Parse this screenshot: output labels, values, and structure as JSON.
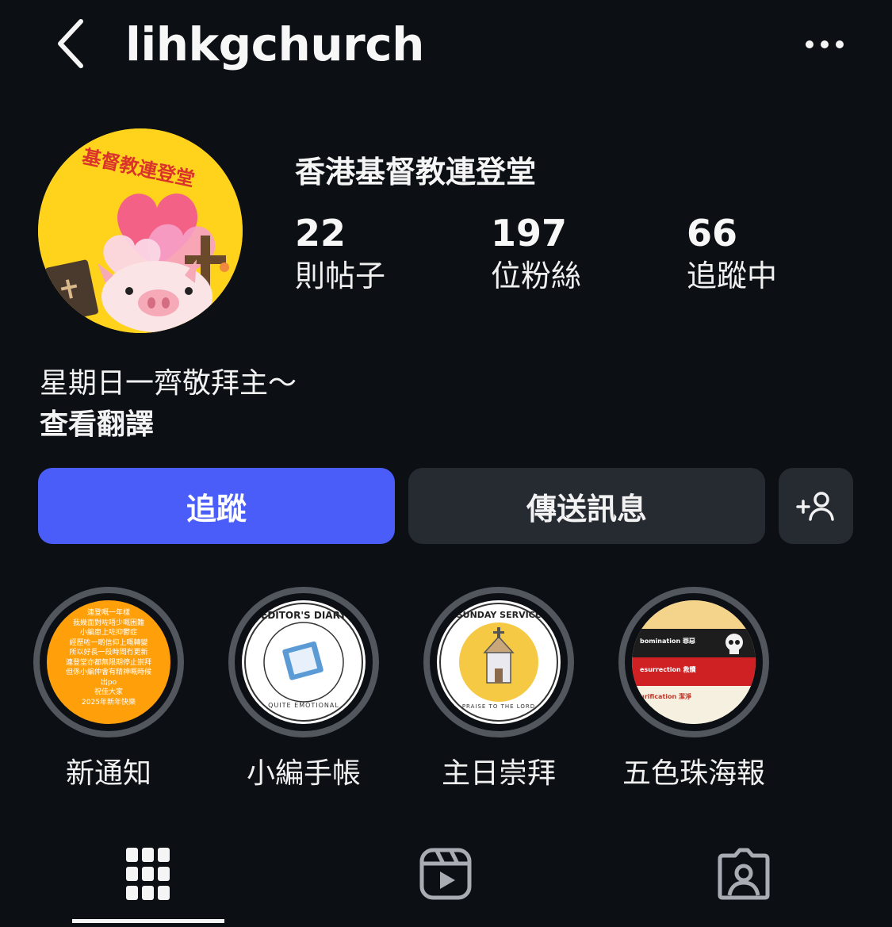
{
  "header": {
    "username": "lihkgchurch"
  },
  "profile": {
    "avatar_text": "基督教連登堂",
    "display_name": "香港基督教連登堂",
    "stats": [
      {
        "value": "22",
        "label": "則帖子"
      },
      {
        "value": "197",
        "label": "位粉絲"
      },
      {
        "value": "66",
        "label": "追蹤中"
      }
    ],
    "bio": "星期日一齊敬拜主～",
    "translate_label": "查看翻譯"
  },
  "actions": {
    "follow_label": "追蹤",
    "message_label": "傳送訊息"
  },
  "highlights": [
    {
      "label": "新通知",
      "cover_lines": [
        "連登嘅一年樣",
        "我幾面對咗唔少嘅困難",
        "小編患上咗抑鬱症",
        "經歷咗一啲信仰上嘅轉變",
        "所以好長一段時間冇更新",
        "連登堂亦都無限期停止崇拜",
        "但係小編仲會有精神嘅時候",
        "出po",
        "祝佳大家",
        "2025年新年快樂"
      ]
    },
    {
      "label": "小編手帳",
      "cover_top": "EDITOR'S DIARY",
      "cover_bottom": "QUITE EMOTIONAL"
    },
    {
      "label": "主日崇拜",
      "cover_top": "SUNDAY SERVICE",
      "cover_bottom": "PRAISE TO THE LORD"
    },
    {
      "label": "五色珠海報",
      "cover_rows": [
        "bomination 罪惡",
        "esurrection 救贖",
        "urification 潔淨"
      ]
    }
  ],
  "colors": {
    "accent": "#4a5df9",
    "background": "#0c0f14",
    "button_secondary": "#262a31"
  },
  "tabs": [
    {
      "icon": "grid-icon",
      "active": true
    },
    {
      "icon": "reels-icon",
      "active": false
    },
    {
      "icon": "tagged-icon",
      "active": false
    }
  ]
}
